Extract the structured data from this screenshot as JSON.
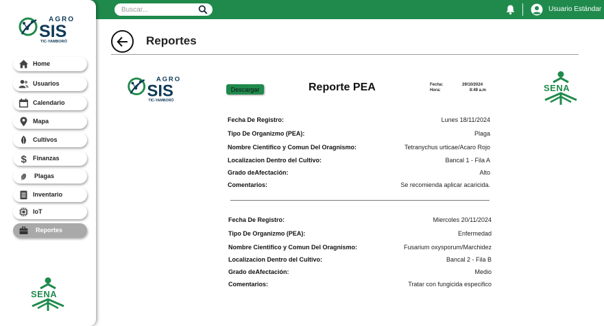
{
  "topbar": {
    "search_placeholder": "Buscar...",
    "user_name": "Usuario Estándar",
    "bar_color": "#1f8a4c"
  },
  "brand": {
    "agro": "AGRO",
    "sis": "SIS",
    "sub": "TIC-YAMBORÓ",
    "sena": "SENA"
  },
  "sidebar": {
    "items": [
      {
        "label": "Home",
        "icon": "home-icon"
      },
      {
        "label": "Usuarios",
        "icon": "users-icon"
      },
      {
        "label": "Calendario",
        "icon": "calendar-icon"
      },
      {
        "label": "Mapa",
        "icon": "map-pin-icon"
      },
      {
        "label": "Cultivos",
        "icon": "leaf-icon"
      },
      {
        "label": "Finanzas",
        "icon": "dollar-icon"
      },
      {
        "label": "Plagas",
        "icon": "bug-icon"
      },
      {
        "label": "Inventario",
        "icon": "clipboard-icon"
      },
      {
        "label": "IoT",
        "icon": "chip-icon"
      },
      {
        "label": "Reportes",
        "icon": "briefcase-icon",
        "active": true
      }
    ]
  },
  "page": {
    "title": "Reportes"
  },
  "report": {
    "download_label": "Descargar",
    "title": "Reporte PEA",
    "fecha_label": "Fecha:",
    "fecha_value": "29/10/2024",
    "hora_label": "Hora:",
    "hora_value": "8:49 a.m",
    "records": [
      {
        "fields": [
          {
            "label": "Fecha De Registro:",
            "value": "Lunes 18/11/2024"
          },
          {
            "label": "Tipo De Organizmo (PEA):",
            "value": "Plaga"
          },
          {
            "label": "Nombre Cientifico y Comun Del Oragnismo:",
            "value": "Tetranychus urticae/Acaro Rojo"
          },
          {
            "label": "Localizacion Dentro del Cultivo:",
            "value": "Bancal 1 - Fila A"
          },
          {
            "label": "Grado deAfectación:",
            "value": "Alto"
          },
          {
            "label": "Comentarios:",
            "value": "Se recomienda aplicar acaricida."
          }
        ]
      },
      {
        "fields": [
          {
            "label": "Fecha De Registro:",
            "value": "Miercoles 20/11/2024"
          },
          {
            "label": "Tipo De Organizmo (PEA):",
            "value": "Enfermedad"
          },
          {
            "label": "Nombre Cientifico y Comun Del Oragnismo:",
            "value": "Fusarium oxysporum/Marchidez"
          },
          {
            "label": "Localizacion Dentro del Cultivo:",
            "value": "Bancal 2 - Fila B"
          },
          {
            "label": "Grado deAfectación:",
            "value": "Medio"
          },
          {
            "label": "Comentarios:",
            "value": "Tratar con fungicida especifico"
          }
        ]
      }
    ]
  }
}
